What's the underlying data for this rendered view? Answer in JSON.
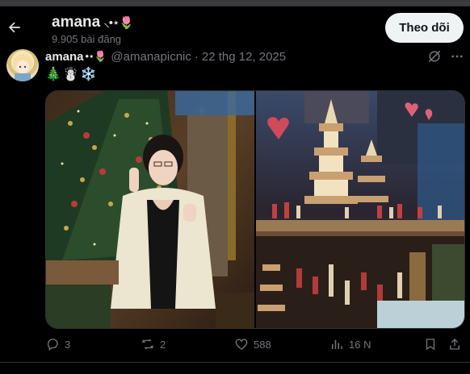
{
  "header": {
    "back_label": "Back",
    "name": "amana",
    "name_emoji": "⸜•⋆🌷",
    "post_count": "9.905 bài đăng",
    "follow_label": "Theo dõi"
  },
  "post": {
    "name": "amana",
    "name_emoji": "•⋆🌷",
    "handle": "@amanapicnic",
    "separator": "·",
    "date": "22 thg 12, 2025",
    "text": "🎄☃️❄️",
    "actions": {
      "replies": "3",
      "reposts": "2",
      "likes": "588",
      "views": "16 N"
    }
  },
  "icons": [
    "back-arrow-icon",
    "grok-icon",
    "more-icon",
    "reply-icon",
    "repost-icon",
    "like-icon",
    "views-icon",
    "bookmark-icon",
    "share-icon"
  ],
  "colors": {
    "background": "#000000",
    "text_primary": "#e7e9ea",
    "text_secondary": "#71767b",
    "follow_bg": "#eff3f4"
  }
}
